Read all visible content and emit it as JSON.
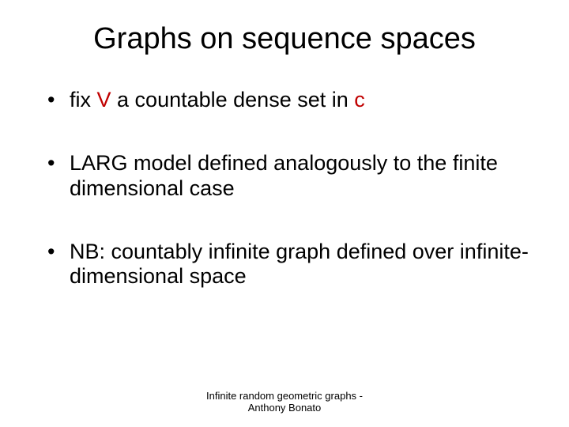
{
  "title": "Graphs on sequence spaces",
  "bullets": {
    "b1": {
      "pre": "fix ",
      "v": "V",
      "mid": " a countable dense set in ",
      "c": "c"
    },
    "b2": "LARG model defined analogously to the finite dimensional case",
    "b3": "NB: countably infinite graph defined over infinite-dimensional space"
  },
  "footer": {
    "line1": "Infinite random geometric graphs -",
    "line2": "Anthony Bonato"
  }
}
